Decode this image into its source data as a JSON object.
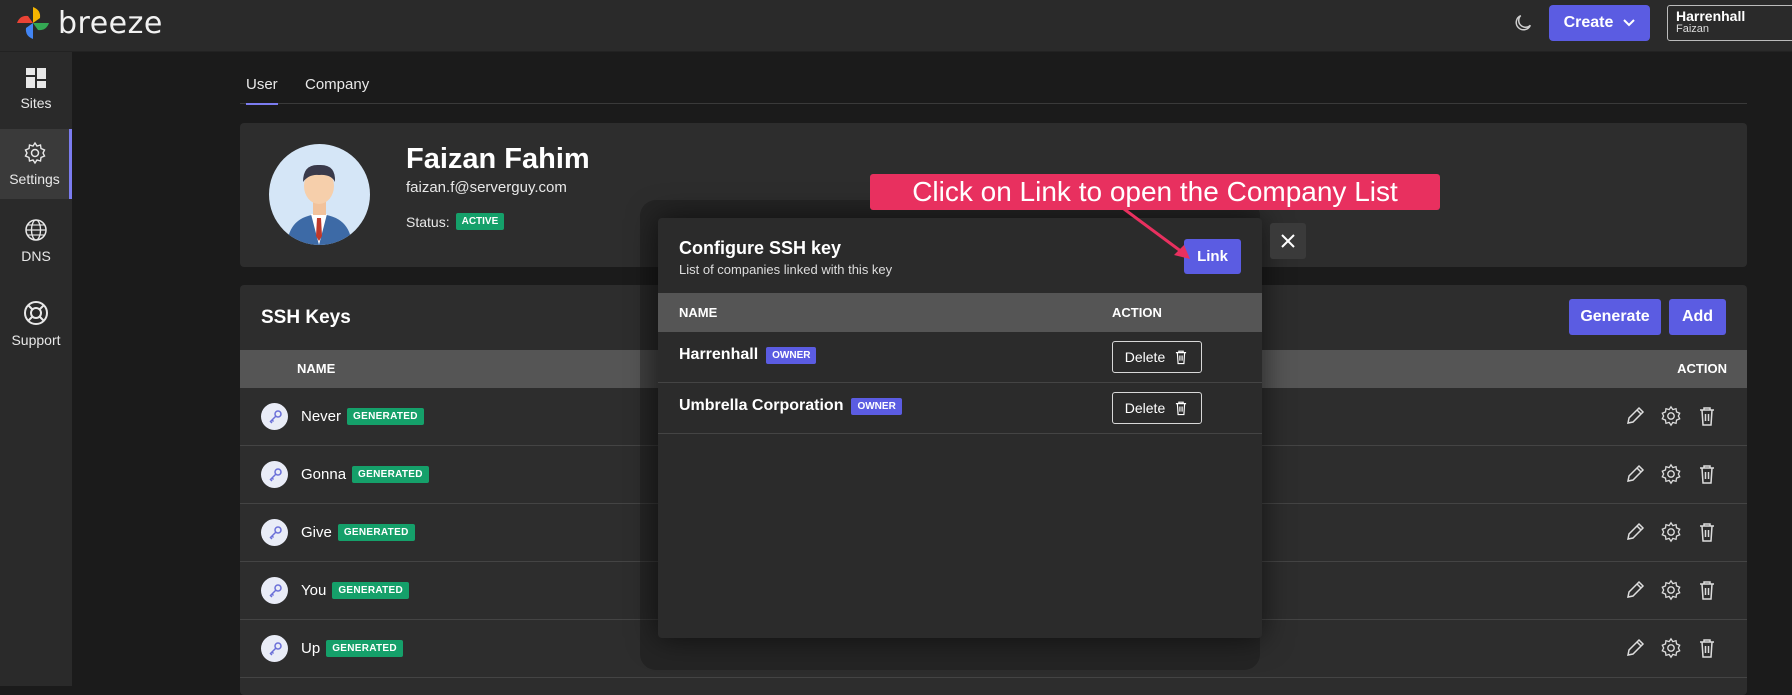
{
  "app": {
    "name": "breeze"
  },
  "header": {
    "create_label": "Create",
    "account_name": "Harrenhall",
    "account_user": "Faizan"
  },
  "sidebar": {
    "items": [
      {
        "label": "Sites",
        "icon": "grid-icon"
      },
      {
        "label": "Settings",
        "icon": "gear-icon",
        "active": true
      },
      {
        "label": "DNS",
        "icon": "globe-icon"
      },
      {
        "label": "Support",
        "icon": "lifebuoy-icon"
      }
    ]
  },
  "tabs": [
    {
      "label": "User",
      "active": true
    },
    {
      "label": "Company",
      "active": false
    }
  ],
  "profile": {
    "name": "Faizan Fahim",
    "email": "faizan.f@serverguy.com",
    "status_label": "Status:",
    "status": "ACTIVE"
  },
  "ssh_keys": {
    "title": "SSH Keys",
    "generate_label": "Generate",
    "add_label": "Add",
    "col_name": "NAME",
    "col_action": "ACTION",
    "rows": [
      {
        "name": "Never",
        "badge": "GENERATED"
      },
      {
        "name": "Gonna",
        "badge": "GENERATED"
      },
      {
        "name": "Give",
        "badge": "GENERATED"
      },
      {
        "name": "You",
        "badge": "GENERATED"
      },
      {
        "name": "Up",
        "badge": "GENERATED"
      }
    ]
  },
  "modal": {
    "title": "Configure SSH key",
    "subtitle": "List of companies linked with this key",
    "link_label": "Link",
    "col_name": "NAME",
    "col_action": "ACTION",
    "rows": [
      {
        "company": "Harrenhall",
        "badge": "OWNER",
        "delete_label": "Delete"
      },
      {
        "company": "Umbrella Corporation",
        "badge": "OWNER",
        "delete_label": "Delete"
      }
    ]
  },
  "callout": {
    "text": "Click on Link to open the Company List"
  },
  "colors": {
    "accent": "#5b5ce2",
    "success": "#15a06a",
    "callout": "#e8305f"
  }
}
